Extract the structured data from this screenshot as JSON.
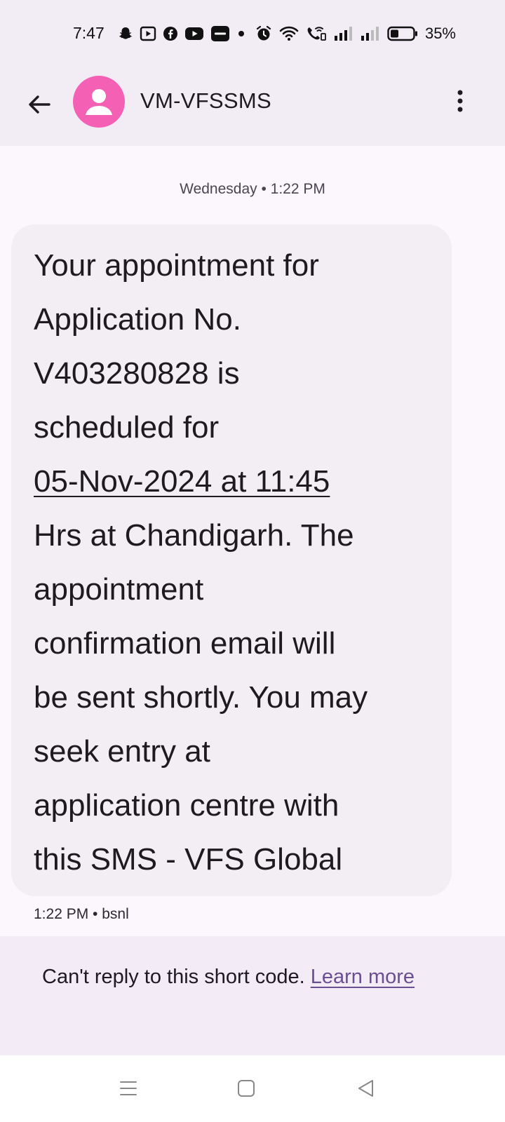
{
  "status_bar": {
    "time": "7:47",
    "battery_percent": "35%",
    "icons": [
      "snapchat-icon",
      "video-player-icon",
      "facebook-icon",
      "youtube-icon",
      "zomato-icon",
      "dot-icon",
      "alarm-icon",
      "wifi-icon",
      "wifi-calling-icon",
      "signal-icon",
      "signal-icon",
      "battery-icon"
    ],
    "battery_level": 0.35
  },
  "app_bar": {
    "title": "VM-VFSSMS",
    "avatar_color": "#f461b4"
  },
  "conversation": {
    "date_label": "Wednesday • 1:22 PM",
    "message": {
      "lines": [
        "Your appointment for",
        "Application No.",
        "V403280828 is",
        "scheduled for",
        "05-Nov-2024 at 11:45",
        "Hrs at Chandigarh. The",
        "appointment",
        "confirmation email will",
        "be sent shortly. You may",
        "seek entry at",
        "application centre with",
        "this SMS - VFS Global"
      ],
      "timestamp": "1:22 PM • bsnl"
    }
  },
  "notice": {
    "text": "Can't reply to this short code. ",
    "link": "Learn more"
  },
  "nav_bar": {
    "buttons": [
      "menu-icon",
      "home-icon",
      "back-triangle-icon"
    ]
  }
}
